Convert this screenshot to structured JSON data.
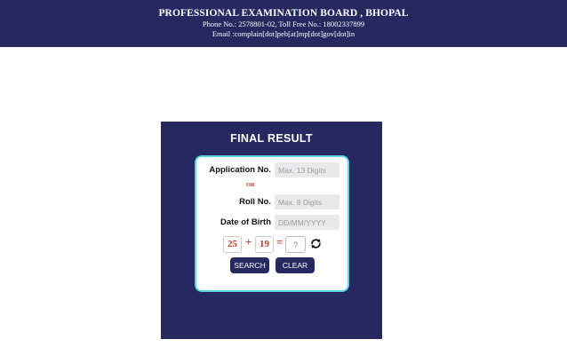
{
  "header": {
    "title": "PROFESSIONAL EXAMINATION BOARD , BHOPAL",
    "phone": "Phone No.: 2578801-02, Toll Free No.: 18002337899",
    "email": "Email :complain[dot]peb[at]mp[dot]gov[dot]in"
  },
  "result_panel": {
    "title": "FINAL RESULT",
    "application_label": "Application No.",
    "application_placeholder": "Max. 13 Digits",
    "or_text": "OR",
    "roll_label": "Roll No.",
    "roll_placeholder": "Max. 8 Digits",
    "dob_label": "Date of Birth",
    "dob_placeholder": "DD/MM/YYYY",
    "captcha": {
      "num1": "25",
      "operator": "+",
      "num2": "19",
      "equals": "=",
      "answer_placeholder": "?",
      "refresh_icon": "refresh-icon"
    },
    "search_label": "SEARCH",
    "clear_label": "CLEAR"
  },
  "colors": {
    "navy": "#252960",
    "cyan_border": "#5bd3e6",
    "captcha_red": "#c0392b"
  }
}
